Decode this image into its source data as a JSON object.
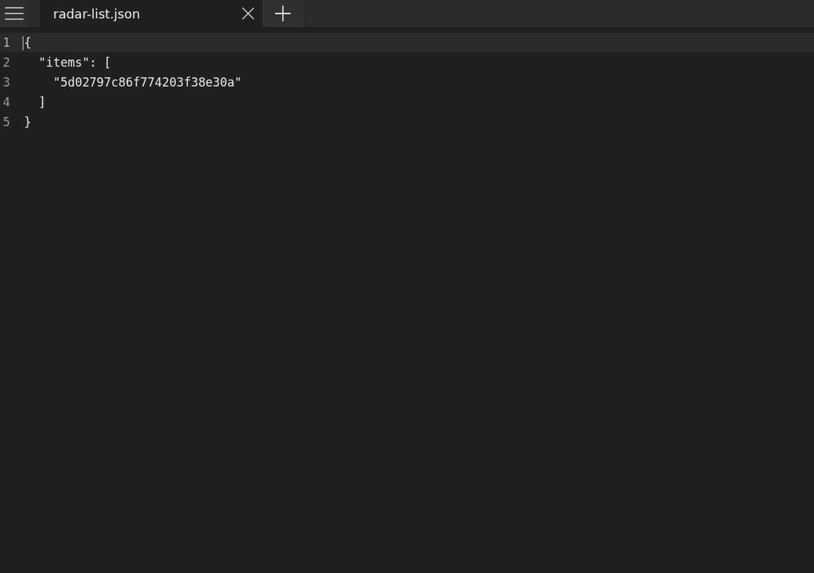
{
  "tabs": [
    {
      "label": "radar-list.json",
      "selected": true
    }
  ],
  "editor": {
    "lines": [
      {
        "number": "1",
        "text": "{",
        "current": true
      },
      {
        "number": "2",
        "text": "  \"items\": [",
        "current": false
      },
      {
        "number": "3",
        "text": "    \"5d02797c86f774203f38e30a\"",
        "current": false
      },
      {
        "number": "4",
        "text": "  ]",
        "current": false
      },
      {
        "number": "5",
        "text": "}",
        "current": false
      }
    ]
  }
}
